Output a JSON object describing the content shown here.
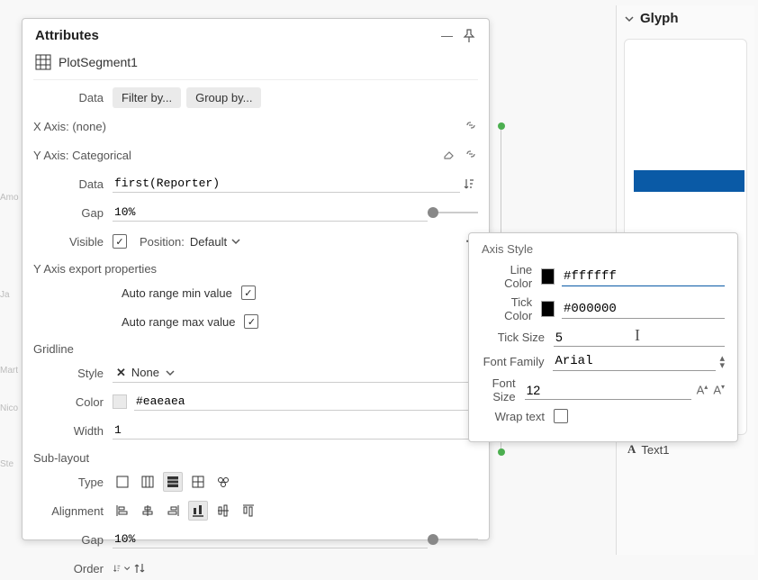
{
  "panel": {
    "title": "Attributes",
    "object_name": "PlotSegment1",
    "data_label": "Data",
    "filter_chip": "Filter by...",
    "group_chip": "Group by...",
    "xaxis_label": "X Axis: (none)",
    "yaxis_label": "Y Axis: Categorical",
    "y_data_label": "Data",
    "y_data_value": "first(Reporter)",
    "gap_label": "Gap",
    "gap_value": "10%",
    "visible_label": "Visible",
    "visible_checked": true,
    "position_label": "Position:",
    "position_value": "Default",
    "export_label": "Y Axis export properties",
    "auto_min": "Auto range min value",
    "auto_min_checked": true,
    "auto_max": "Auto range max value",
    "auto_max_checked": true,
    "gridline_label": "Gridline",
    "style_label": "Style",
    "style_value": "None",
    "color_label": "Color",
    "color_value": "#eaeaea",
    "width_label": "Width",
    "width_value": "1",
    "sublayout_label": "Sub-layout",
    "type_label": "Type",
    "align_label": "Alignment",
    "sub_gap_label": "Gap",
    "sub_gap_value": "10%",
    "order_label": "Order"
  },
  "axis": {
    "title": "Axis Style",
    "line_color_label": "Line Color",
    "line_color_value": "#ffffff",
    "tick_color_label": "Tick Color",
    "tick_color_value": "#000000",
    "tick_size_label": "Tick Size",
    "tick_size_value": "5",
    "font_family_label": "Font Family",
    "font_family_value": "Arial",
    "font_size_label": "Font Size",
    "font_size_value": "12",
    "wrap_label": "Wrap text",
    "wrap_checked": false
  },
  "glyph": {
    "title": "Glyph",
    "text1": "Text1"
  },
  "bg_labels": [
    "Amo",
    "Ja",
    "Mart",
    "Nico",
    "Ste"
  ]
}
